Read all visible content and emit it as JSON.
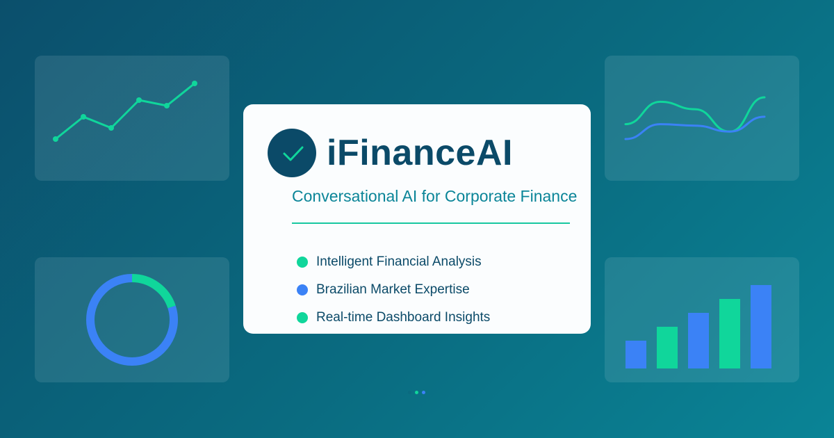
{
  "colors": {
    "green": "#10d69b",
    "blue": "#3b82f6",
    "navy": "#0b4a68",
    "teal_text": "#0b8598"
  },
  "brand": {
    "logo_icon": "checkmark-icon",
    "name": "iFinanceAI",
    "tagline": "Conversational AI for Corporate Finance"
  },
  "features": [
    {
      "label": "Intelligent Financial Analysis",
      "color": "#10d69b"
    },
    {
      "label": "Brazilian Market Expertise",
      "color": "#3b82f6"
    },
    {
      "label": "Real-time Dashboard Insights",
      "color": "#10d69b"
    }
  ],
  "chart_data": [
    {
      "type": "line",
      "values": [
        1,
        3,
        2,
        4.5,
        4,
        6
      ],
      "color": "#10d69b"
    },
    {
      "type": "line",
      "series": [
        {
          "values": [
            2,
            3.5,
            3,
            1.5,
            3.8
          ],
          "color": "#10d69b"
        },
        {
          "values": [
            1,
            2,
            1.9,
            1.5,
            2.5
          ],
          "color": "#3b82f6"
        }
      ]
    },
    {
      "type": "pie",
      "values": [
        20,
        80
      ],
      "colors": [
        "#10d69b",
        "#3b82f6"
      ]
    },
    {
      "type": "bar",
      "values": [
        2,
        3,
        4,
        5,
        6
      ],
      "colors": [
        "#3b82f6",
        "#10d69b",
        "#3b82f6",
        "#10d69b",
        "#3b82f6"
      ]
    }
  ],
  "pager": {
    "count": 3,
    "active_index": 1,
    "colors": [
      "#0b6a80",
      "#10d69b",
      "#3b82f6"
    ]
  }
}
